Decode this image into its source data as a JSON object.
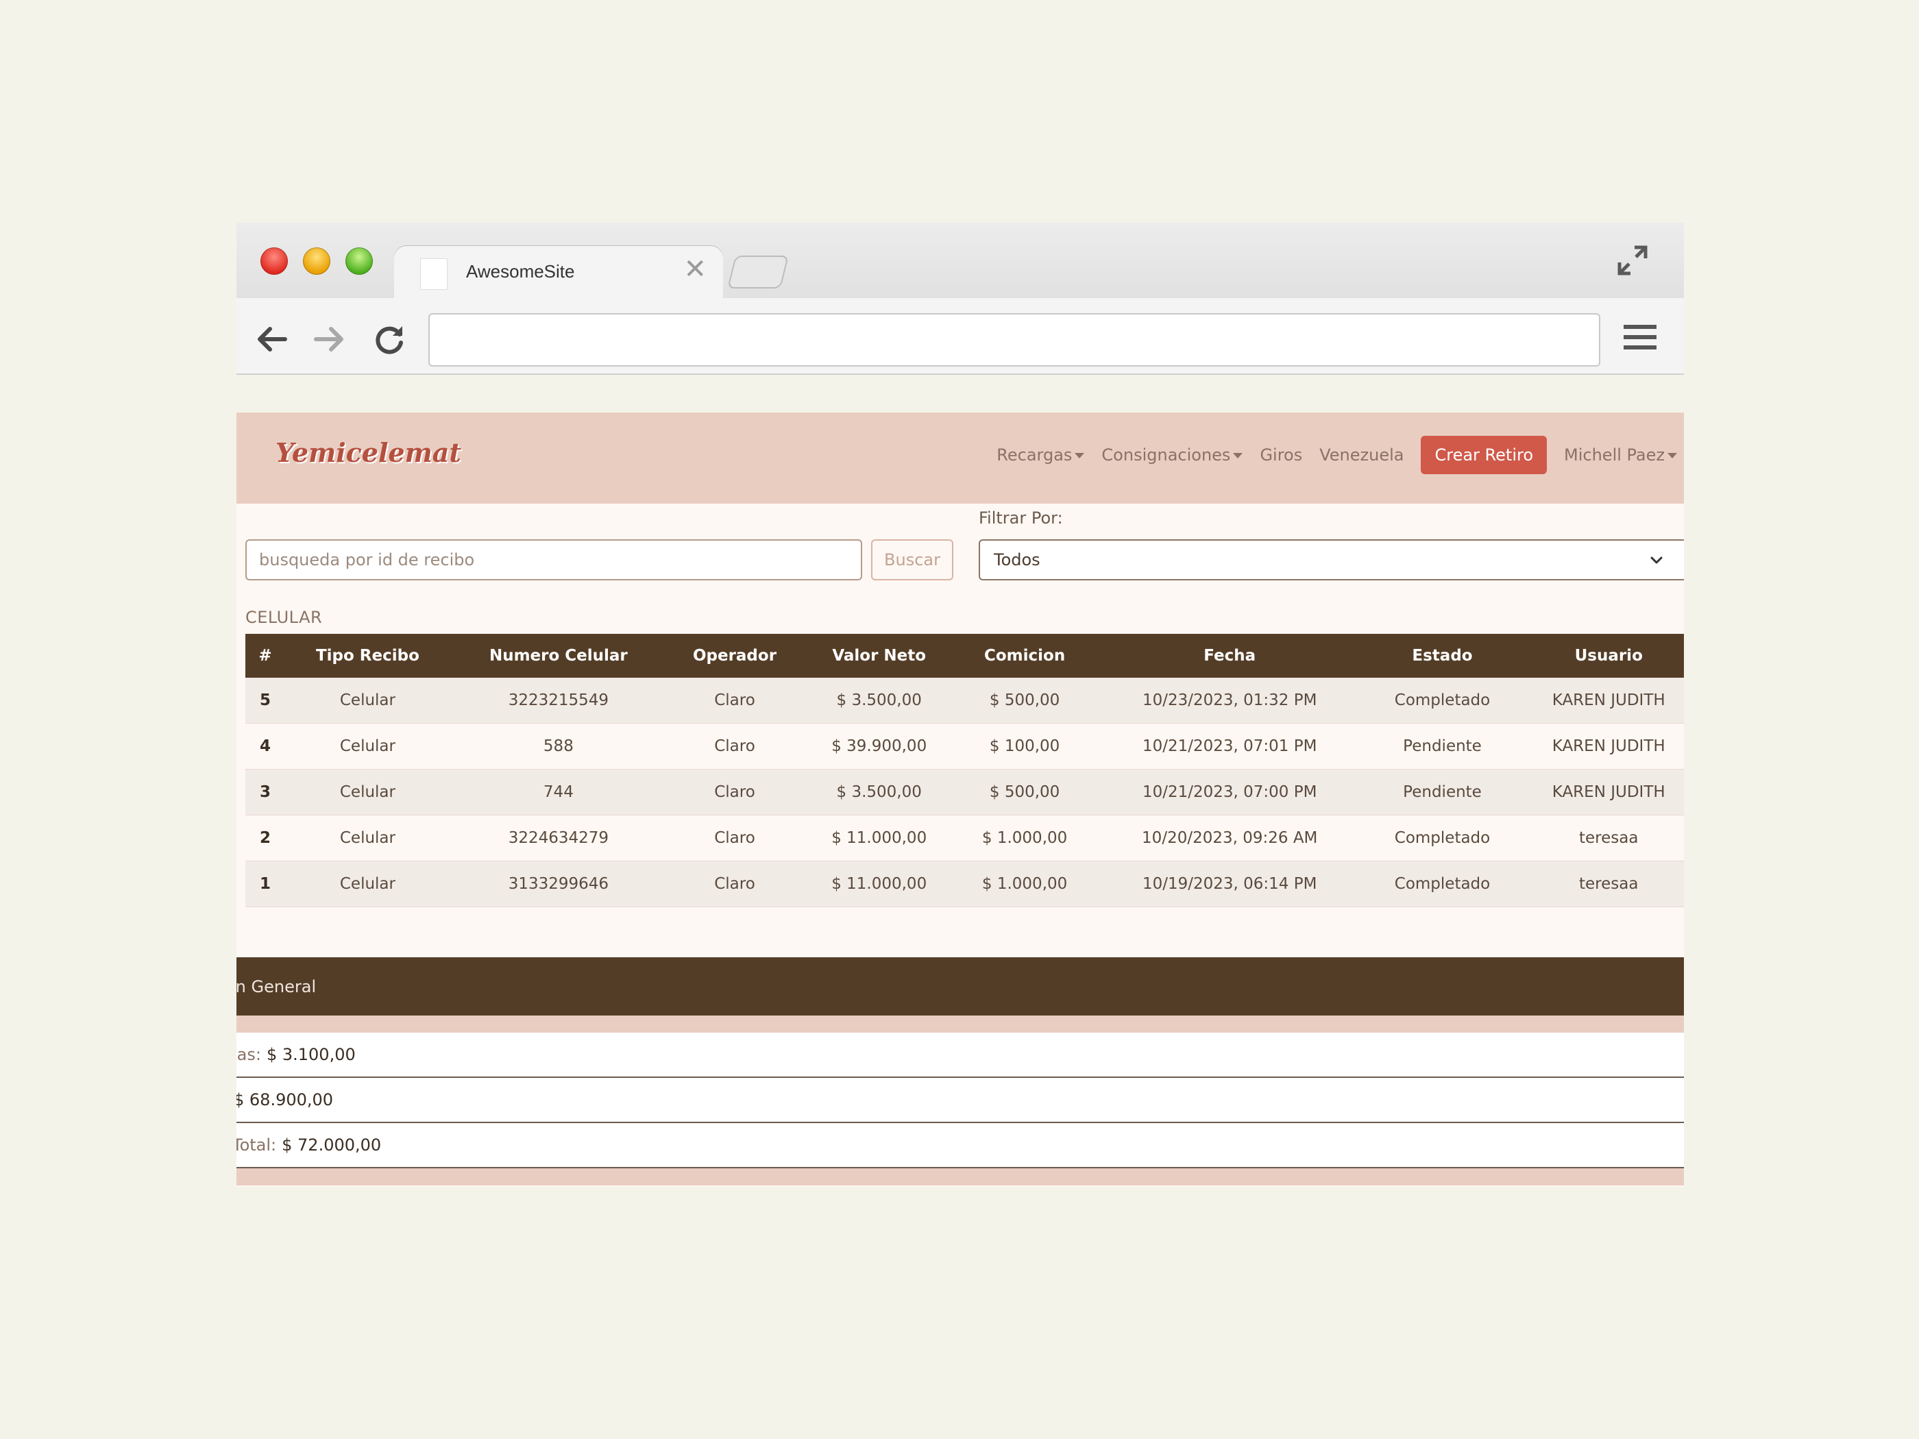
{
  "browser": {
    "tab_title": "AwesomeSite",
    "tab_close": "✕",
    "url": ""
  },
  "navbar": {
    "brand": "Yemicelemat",
    "links": [
      {
        "label": "Recargas",
        "dropdown": true
      },
      {
        "label": "Consignaciones",
        "dropdown": true
      },
      {
        "label": "Giros",
        "dropdown": false
      },
      {
        "label": "Venezuela",
        "dropdown": false
      }
    ],
    "cta": "Crear Retiro",
    "user": "Michell Paez"
  },
  "search": {
    "placeholder": "busqueda por id de recibo",
    "button": "Buscar"
  },
  "filter": {
    "label": "Filtrar Por:",
    "selected": "Todos"
  },
  "section_label": "CELULAR",
  "table": {
    "headers": [
      "#",
      "Tipo Recibo",
      "Numero Celular",
      "Operador",
      "Valor Neto",
      "Comicion",
      "Fecha",
      "Estado",
      "Usuario"
    ],
    "rows": [
      [
        "5",
        "Celular",
        "3223215549",
        "Claro",
        "$ 3.500,00",
        "$ 500,00",
        "10/23/2023, 01:32 PM",
        "Completado",
        "KAREN JUDITH"
      ],
      [
        "4",
        "Celular",
        "588",
        "Claro",
        "$ 39.900,00",
        "$ 100,00",
        "10/21/2023, 07:01 PM",
        "Pendiente",
        "KAREN JUDITH"
      ],
      [
        "3",
        "Celular",
        "744",
        "Claro",
        "$ 3.500,00",
        "$ 500,00",
        "10/21/2023, 07:00 PM",
        "Pendiente",
        "KAREN JUDITH"
      ],
      [
        "2",
        "Celular",
        "3224634279",
        "Claro",
        "$ 11.000,00",
        "$ 1.000,00",
        "10/20/2023, 09:26 AM",
        "Completado",
        "teresaa"
      ],
      [
        "1",
        "Celular",
        "3133299646",
        "Claro",
        "$ 11.000,00",
        "$ 1.000,00",
        "10/19/2023, 06:14 PM",
        "Completado",
        "teresaa"
      ]
    ]
  },
  "summary": {
    "title": "on General",
    "rows": [
      {
        "label": "ias:",
        "value": "$ 3.100,00"
      },
      {
        "label": "",
        "value": "$ 68.900,00"
      },
      {
        "label": "Total:",
        "value": "$ 72.000,00"
      }
    ]
  },
  "colors": {
    "navbar_bg": "#e9cdc1",
    "table_header_bg": "#543d27",
    "cta_bg": "#d0594a",
    "brand": "#b5503f"
  }
}
